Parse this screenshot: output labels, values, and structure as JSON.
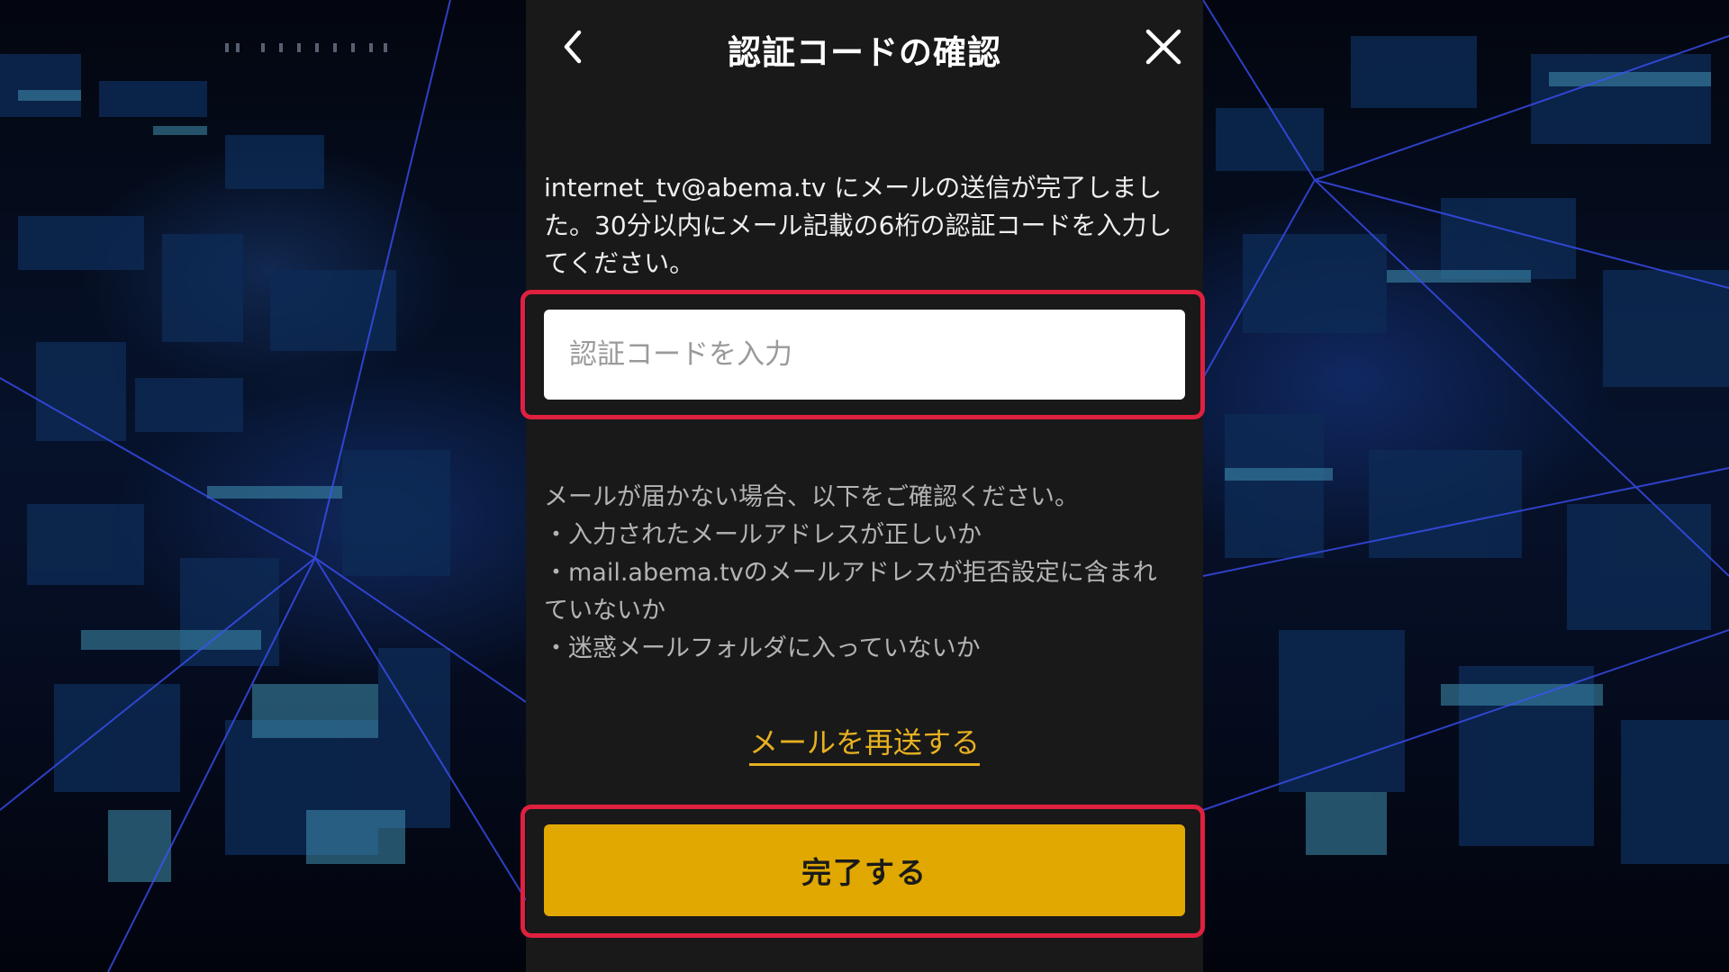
{
  "header": {
    "title": "認証コードの確認"
  },
  "intro": {
    "line1": "internet_tv@abema.tv にメールの送信が完了しまし",
    "line2": "た。30分以内にメール記載の6桁の認証コードを入力し",
    "line3": "てください。"
  },
  "code_input": {
    "value": "",
    "placeholder": "認証コードを入力"
  },
  "help": {
    "heading": "メールが届かない場合、以下をご確認ください。",
    "items": [
      "・入力されたメールアドレスが正しいか",
      "・mail.abema.tvのメールアドレスが拒否設定に含まれ",
      "ていないか",
      "・迷惑メールフォルダに入っていないか"
    ]
  },
  "resend_label": "メールを再送する",
  "done_label": "完了する",
  "colors": {
    "panel": "#191919",
    "accent": "#e0a800",
    "link": "#e6b021",
    "highlight": "#e0203f"
  }
}
